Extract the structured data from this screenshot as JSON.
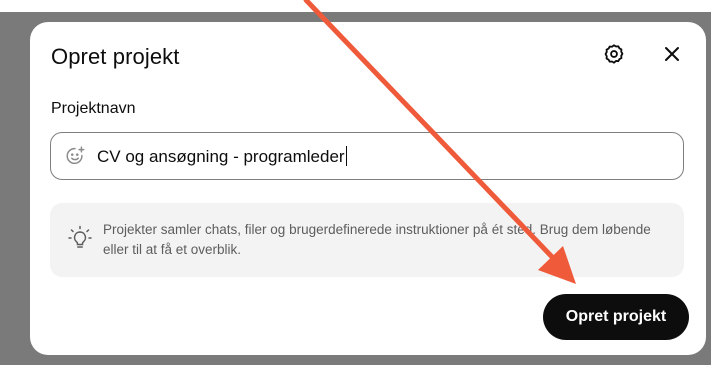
{
  "dialog": {
    "title": "Opret projekt",
    "field_label": "Projektnavn",
    "name_value": "CV og ansøgning - programleder",
    "info_text": "Projekter samler chats, filer og brugerdefinerede instruktioner på ét sted. Brug dem løbende eller til at få et overblik.",
    "create_button_label": "Opret projekt"
  },
  "icons": {
    "settings": "gear-icon",
    "close": "close-icon",
    "emoji": "emoji-add-icon",
    "tip": "lightbulb-icon"
  },
  "colors": {
    "annotation_arrow": "#ef5a3a",
    "primary_button": "#0d0d0d",
    "info_background": "#f3f3f3"
  }
}
